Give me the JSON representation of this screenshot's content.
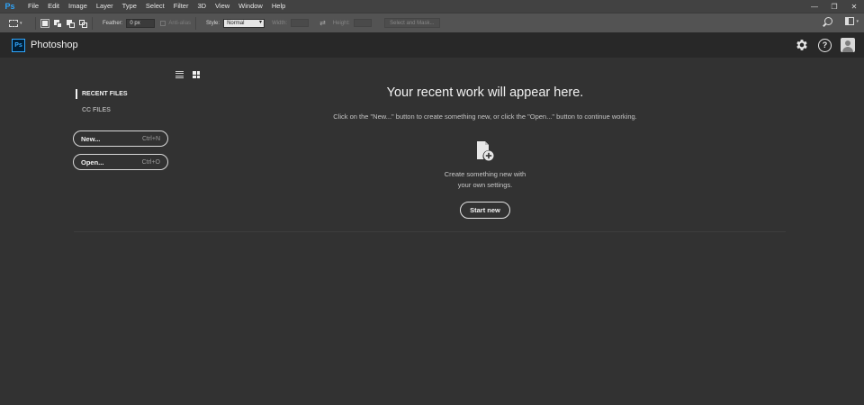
{
  "menubar": {
    "logo": "Ps",
    "items": [
      "File",
      "Edit",
      "Image",
      "Layer",
      "Type",
      "Select",
      "Filter",
      "3D",
      "View",
      "Window",
      "Help"
    ]
  },
  "options_bar": {
    "feather_label": "Feather:",
    "feather_value": "0 px",
    "anti_alias_label": "Anti-alias",
    "style_label": "Style:",
    "style_value": "Normal",
    "width_label": "Width:",
    "height_label": "Height:",
    "select_mask_label": "Select and Mask..."
  },
  "header": {
    "badge": "Ps",
    "app_name": "Photoshop",
    "help_glyph": "?"
  },
  "sidebar": {
    "tabs": [
      {
        "label": "RECENT FILES",
        "active": true
      },
      {
        "label": "CC FILES",
        "active": false
      }
    ],
    "new_button": {
      "label": "New...",
      "shortcut": "Ctrl+N"
    },
    "open_button": {
      "label": "Open...",
      "shortcut": "Ctrl+O"
    }
  },
  "main": {
    "title": "Your recent work will appear here.",
    "description": "Click on the \"New...\" button to create something new, or click the \"Open...\" button to continue working.",
    "create_line1": "Create something new with",
    "create_line2": "your own settings.",
    "start_new_label": "Start new"
  },
  "colors": {
    "brand": "#31a8ff",
    "background": "#323232",
    "header_bg": "#282828"
  }
}
